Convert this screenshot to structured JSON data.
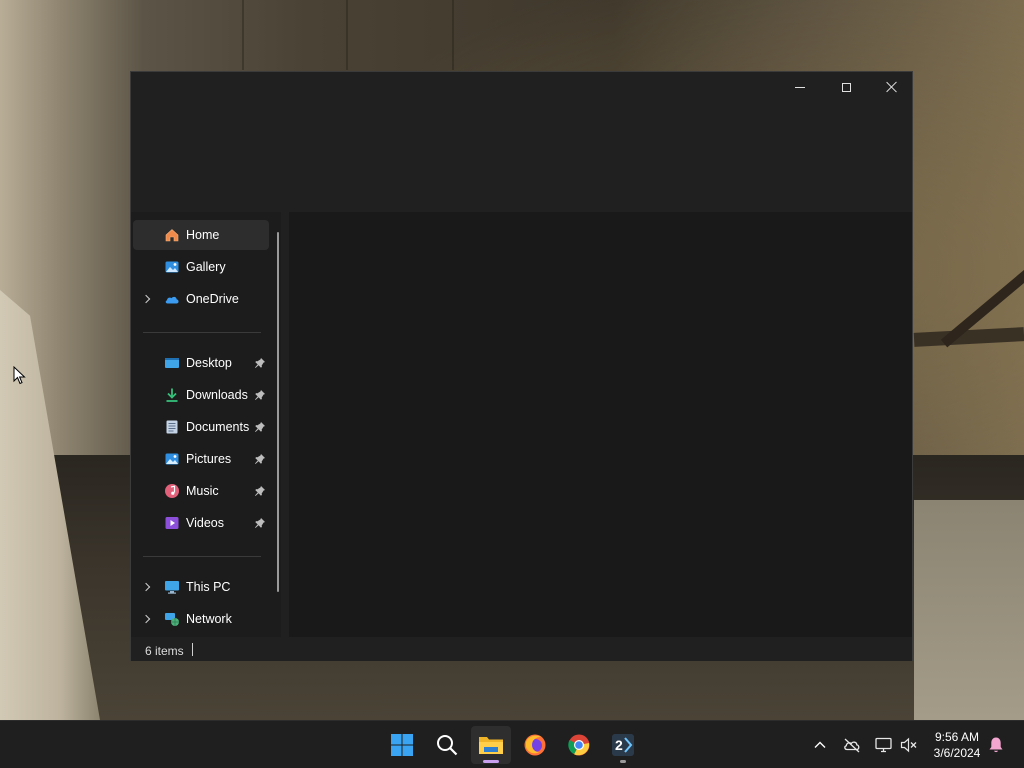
{
  "window": {
    "buttons": {
      "minimize_icon": "minimize-icon",
      "maximize_icon": "maximize-icon",
      "close_icon": "close-icon"
    }
  },
  "navigation": {
    "quick": [
      {
        "label": "Home",
        "icon": "home-icon",
        "selected": true
      },
      {
        "label": "Gallery",
        "icon": "gallery-icon"
      },
      {
        "label": "OneDrive",
        "icon": "onedrive-icon",
        "expandable": true
      }
    ],
    "pinned": [
      {
        "label": "Desktop",
        "icon": "desktop-icon",
        "pinned": true
      },
      {
        "label": "Downloads",
        "icon": "downloads-icon",
        "pinned": true
      },
      {
        "label": "Documents",
        "icon": "documents-icon",
        "pinned": true
      },
      {
        "label": "Pictures",
        "icon": "pictures-icon",
        "pinned": true
      },
      {
        "label": "Music",
        "icon": "music-icon",
        "pinned": true
      },
      {
        "label": "Videos",
        "icon": "videos-icon",
        "pinned": true
      }
    ],
    "devices": [
      {
        "label": "This PC",
        "icon": "this-pc-icon",
        "expandable": true
      },
      {
        "label": "Network",
        "icon": "network-icon",
        "expandable": true
      }
    ]
  },
  "status": {
    "item_count": "6 items"
  },
  "taskbar": {
    "apps": [
      {
        "name": "Start",
        "icon": "windows-start-icon"
      },
      {
        "name": "Search",
        "icon": "search-icon"
      },
      {
        "name": "File Explorer",
        "icon": "file-explorer-icon",
        "active": true
      },
      {
        "name": "Firefox",
        "icon": "firefox-icon"
      },
      {
        "name": "Chrome",
        "icon": "chrome-icon"
      },
      {
        "name": "2X app",
        "icon": "app-2x-icon",
        "running": true
      }
    ],
    "tray": {
      "icons": [
        "chevron-up-icon",
        "onedrive-offline-icon",
        "network-icon",
        "volume-muted-icon",
        "notification-bell-icon"
      ],
      "time": "9:56 AM",
      "date": "3/6/2024"
    }
  },
  "colors": {
    "window_bg": "#202020",
    "content_bg": "#191919",
    "selected_bg": "#2d2d2d",
    "taskbar_bg": "#1f1f1f",
    "accent": "#c9a0f0"
  }
}
